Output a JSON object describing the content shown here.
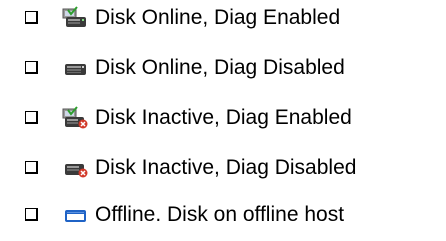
{
  "legend": {
    "items": [
      {
        "label": "Disk Online, Diag Enabled",
        "icon": "disk-online-diag-enabled-icon"
      },
      {
        "label": "Disk Online, Diag Disabled",
        "icon": "disk-online-diag-disabled-icon"
      },
      {
        "label": "Disk Inactive, Diag Enabled",
        "icon": "disk-inactive-diag-enabled-icon"
      },
      {
        "label": "Disk Inactive, Diag Disabled",
        "icon": "disk-inactive-diag-disabled-icon"
      },
      {
        "label": "Offline. Disk on offline host",
        "icon": "disk-offline-host-icon"
      }
    ]
  },
  "colors": {
    "disk_dark": "#3a3a3a",
    "disk_light": "#9a9a9a",
    "diag_green": "#2e9e2e",
    "inactive_red": "#d23a2a",
    "offline_blue": "#1f63c6"
  }
}
